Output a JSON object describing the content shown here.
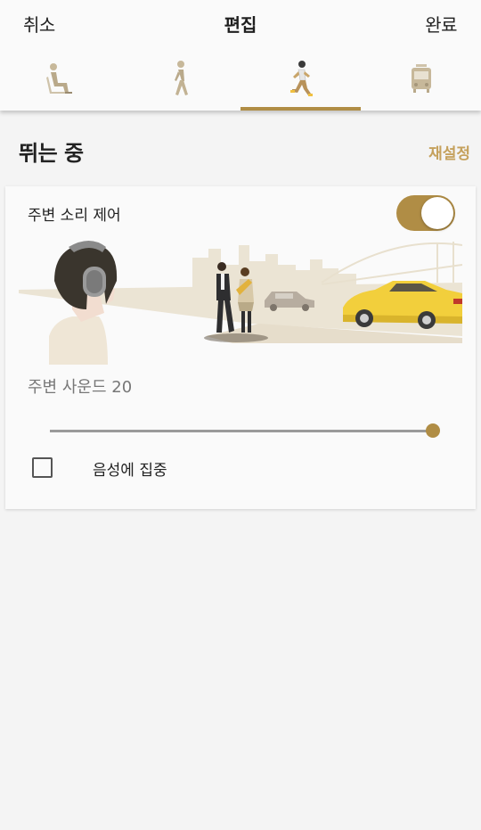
{
  "header": {
    "cancel_label": "취소",
    "title": "편집",
    "done_label": "완료"
  },
  "tabs": [
    {
      "icon": "sitting-person-icon",
      "active": false
    },
    {
      "icon": "walking-person-icon",
      "active": false
    },
    {
      "icon": "running-person-icon",
      "active": true
    },
    {
      "icon": "train-icon",
      "active": false
    }
  ],
  "section": {
    "title": "뛰는 중",
    "reset_label": "재설정"
  },
  "noise_control": {
    "label": "주변 소리 제어",
    "enabled": true
  },
  "ambient_sound": {
    "label": "주변 사운드 20",
    "level": 20,
    "max": 20
  },
  "voice_focus": {
    "label": "음성에 집중",
    "checked": false
  },
  "colors": {
    "accent": "#b08d45",
    "reset_text": "#c5a15c",
    "background": "#f4f4f4",
    "taxi_yellow": "#f2cf3c"
  }
}
